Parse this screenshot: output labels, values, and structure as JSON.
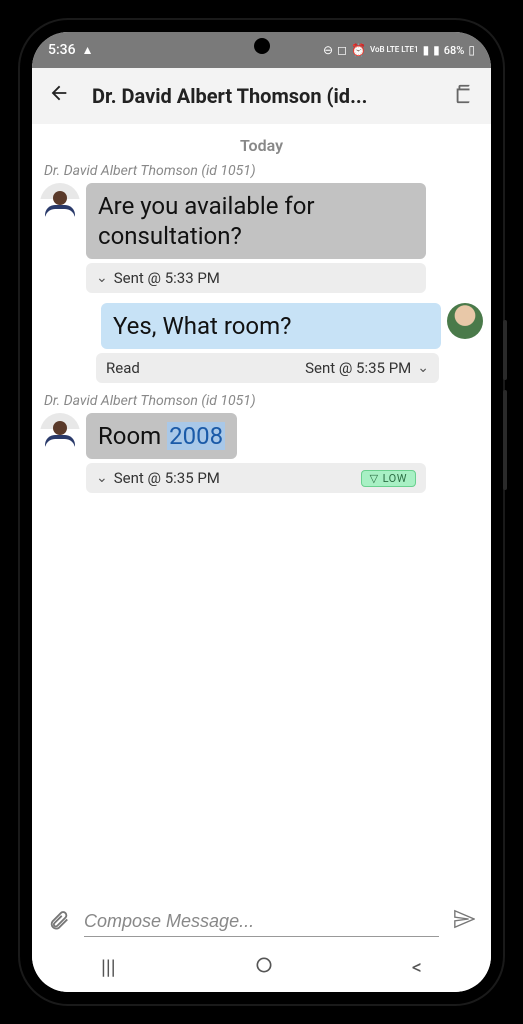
{
  "statusbar": {
    "time": "5:36",
    "battery": "68%",
    "net_labels": "VoB LTE LTE1"
  },
  "header": {
    "title": "Dr. David Albert Thomson (id..."
  },
  "chat": {
    "date_separator": "Today",
    "messages": [
      {
        "from": "other",
        "sender": "Dr. David Albert Thomson (id 1051)",
        "text": "Are you available for consultation?",
        "status": "Sent @ 5:33 PM"
      },
      {
        "from": "self",
        "text": "Yes, What room?",
        "read_label": "Read",
        "status": "Sent @ 5:35 PM"
      },
      {
        "from": "other",
        "sender": "Dr. David Albert Thomson (id 1051)",
        "text_prefix": "Room ",
        "text_highlight": "2008",
        "status": "Sent @ 5:35 PM",
        "priority": "LOW"
      }
    ]
  },
  "compose": {
    "placeholder": "Compose Message..."
  }
}
